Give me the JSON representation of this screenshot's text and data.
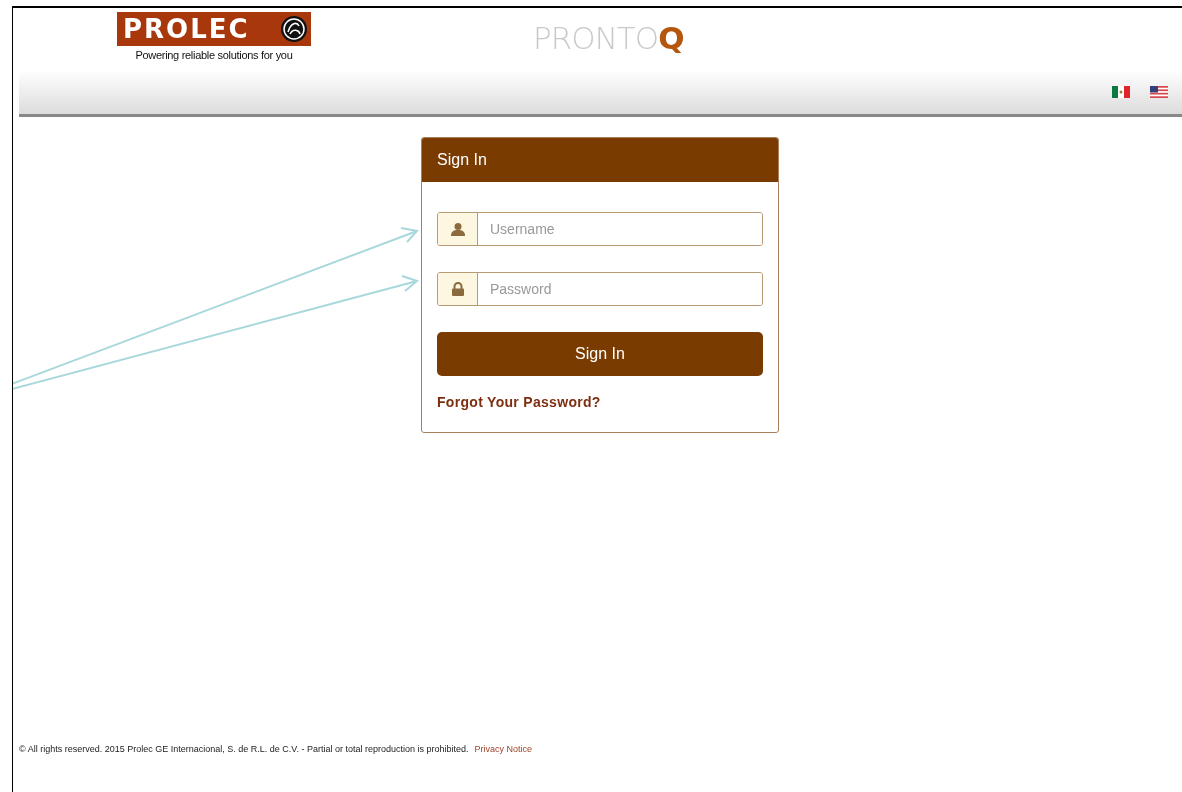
{
  "header": {
    "logo_text": "PROLEC",
    "tagline": "Powering reliable solutions for you",
    "app_title": "PRONTO",
    "app_title_accent": "Q"
  },
  "sign_in": {
    "title": "Sign In",
    "fields": [
      {
        "kind": "user",
        "placeholder": "Username"
      },
      {
        "kind": "lock",
        "placeholder": "Password"
      }
    ],
    "button": "Sign In",
    "forgot_link": "Forgot Your Password?"
  },
  "footer": {
    "copyright": "© All rights reserved. 2015 Prolec GE Internacional, S. de R.L. de C.V. - Partial or total reproduction is prohibited.",
    "privacy_link": "Privacy Notice"
  }
}
